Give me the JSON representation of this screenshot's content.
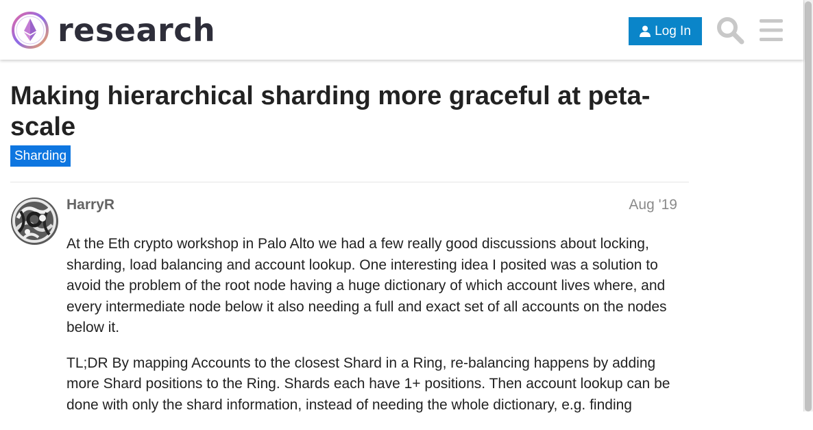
{
  "header": {
    "logo_text": "research",
    "login_label": "Log In",
    "search_icon": "search-icon",
    "menu_icon": "hamburger-menu-icon"
  },
  "topic": {
    "title": "Making hierarchical sharding more graceful at peta-scale",
    "category": "Sharding",
    "category_color": "#0e76e0"
  },
  "post": {
    "username": "HarryR",
    "date": "Aug '19",
    "paragraphs": [
      "At the Eth crypto workshop in Palo Alto we had a few really good discussions about locking, sharding, load balancing and account lookup. One interesting idea I posited was a solution to avoid the problem of the root node having a huge dictionary of which account lives where, and every intermediate node below it also needing a full and exact set of all accounts on the nodes below it.",
      "TL;DR By mapping Accounts to the closest Shard in a Ring, re-balancing happens by adding more Shard positions to the Ring. Shards each have 1+ positions. Then account lookup can be done with only the shard information, instead of needing the whole dictionary, e.g. finding"
    ]
  },
  "colors": {
    "accent": "#0a85c9",
    "text": "#222222",
    "muted": "#8a8a8a"
  }
}
